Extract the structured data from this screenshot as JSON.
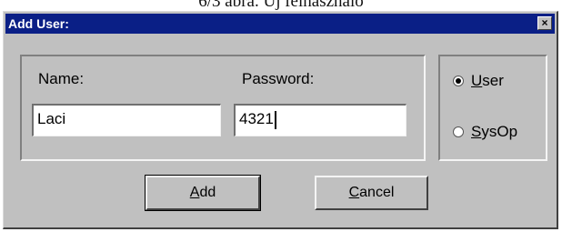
{
  "caption": "6/3 ábra. Új felhasználó",
  "window": {
    "title": "Add User:",
    "close_glyph": "×"
  },
  "fields": {
    "name_label": "Name:",
    "name_value": "Laci",
    "password_label": "Password:",
    "password_value": "4321"
  },
  "role": {
    "options": [
      {
        "mnemonic": "U",
        "rest": "ser",
        "checked": true
      },
      {
        "mnemonic": "S",
        "rest": "ysOp",
        "checked": false
      }
    ]
  },
  "buttons": {
    "add": {
      "mnemonic": "A",
      "rest": "dd"
    },
    "cancel": {
      "mnemonic": "C",
      "rest": "ancel"
    }
  },
  "colors": {
    "titlebar": "#0a1f86",
    "face": "#c0c0c0"
  }
}
